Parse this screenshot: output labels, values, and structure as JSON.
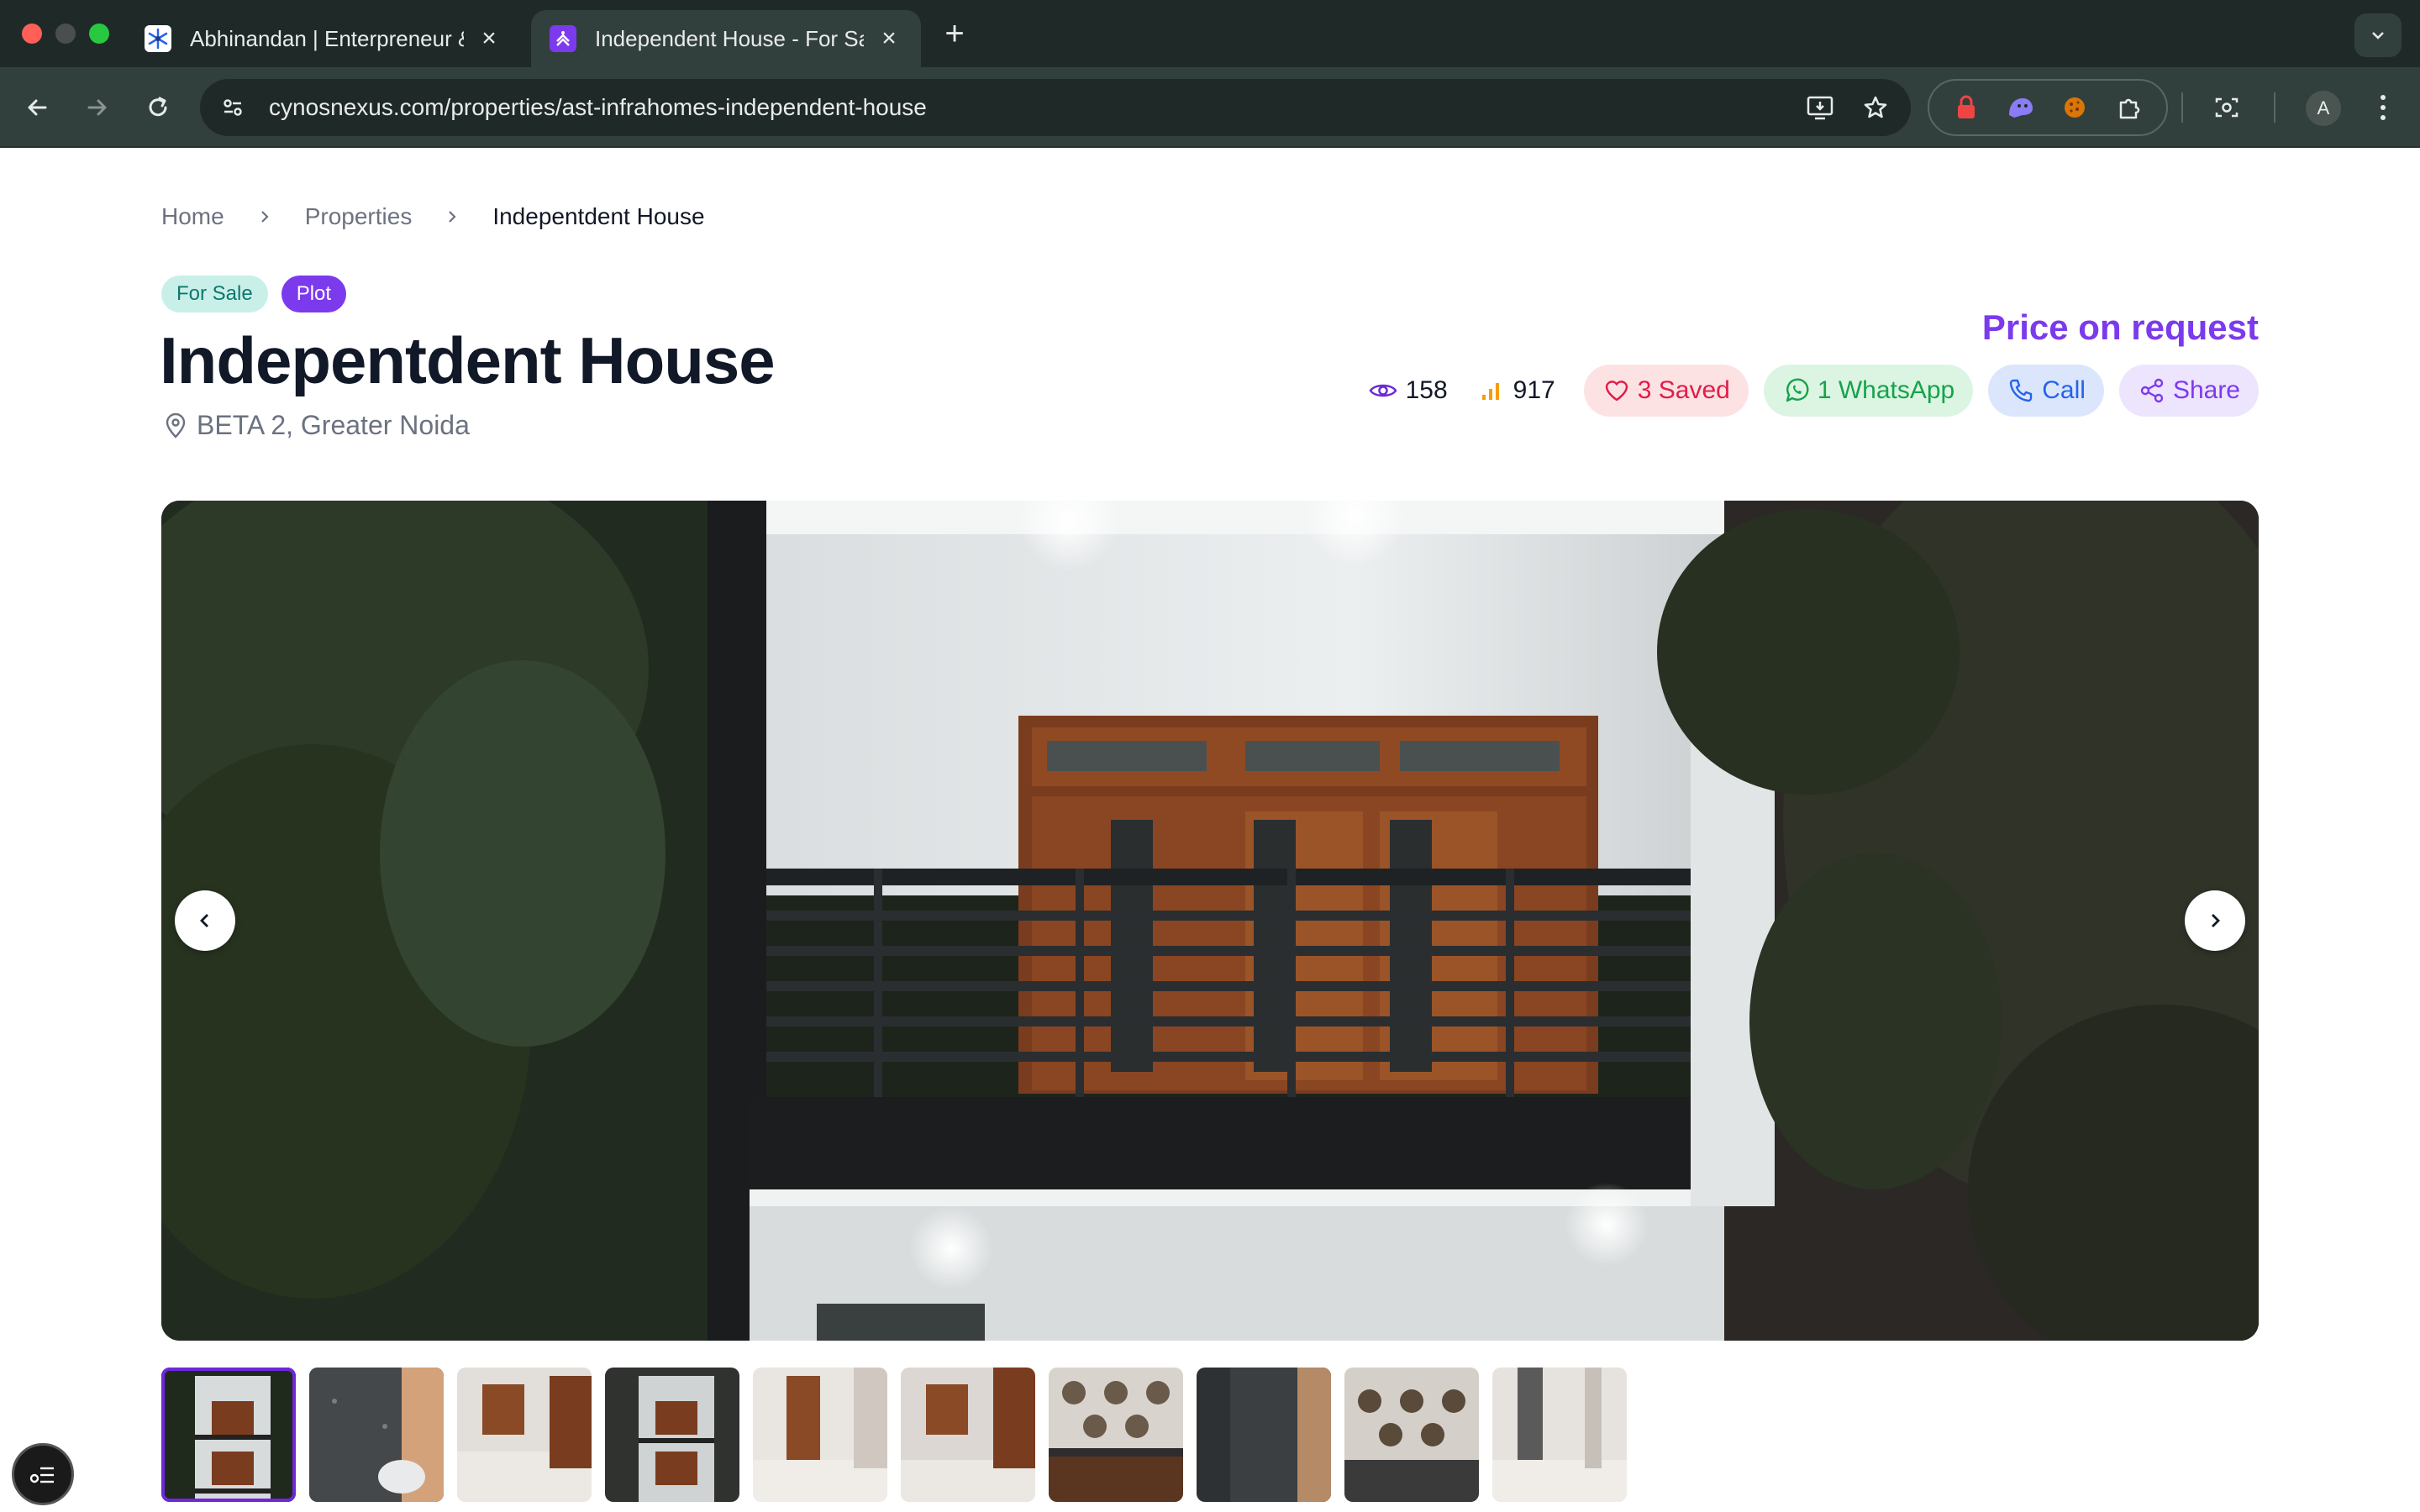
{
  "browser": {
    "tabs": [
      {
        "title": "Abhinandan | Enterpreneur & Tech",
        "active": false
      },
      {
        "title": "Independent House - For Sale",
        "active": true
      }
    ],
    "url": "cynosnexus.com/properties/ast-infrahomes-independent-house",
    "profile_initial": "A"
  },
  "breadcrumb": {
    "home": "Home",
    "properties": "Properties",
    "current": "Indepentdent House"
  },
  "badges": {
    "sale": "For Sale",
    "type": "Plot"
  },
  "property": {
    "title": "Indepentdent House",
    "location": "BETA 2, Greater Noida",
    "price": "Price on request"
  },
  "stats": {
    "views": "158",
    "impressions": "917",
    "saved": "3 Saved",
    "whatsapp": "1 WhatsApp",
    "call": "Call",
    "share": "Share"
  },
  "gallery": {
    "thumbnail_count": 10,
    "selected_index": 0
  },
  "colors": {
    "accent": "#7c3aed",
    "chrome_dark": "#1f2a28",
    "chrome_toolbar": "#32403d"
  }
}
